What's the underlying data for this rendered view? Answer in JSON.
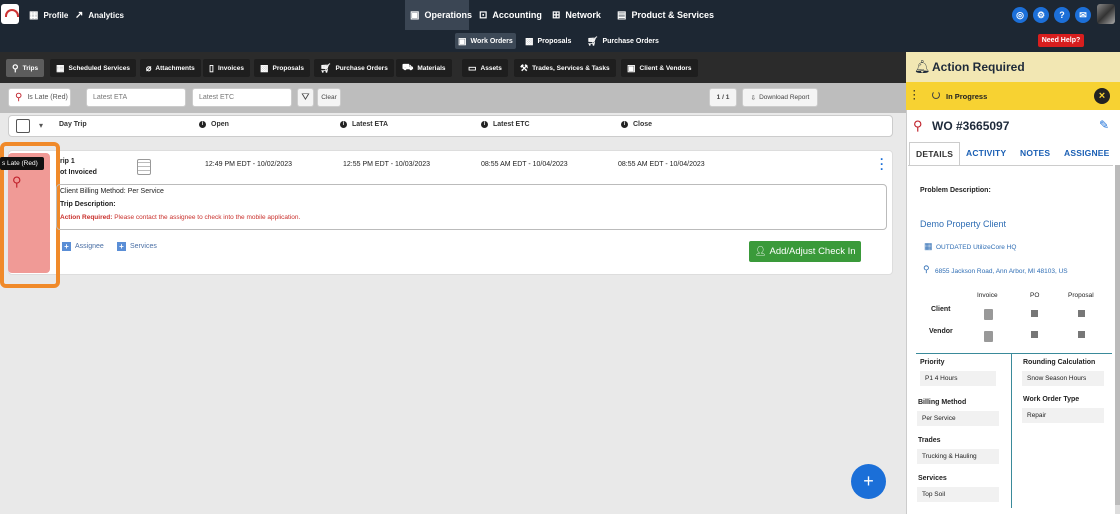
{
  "topnav": {
    "profile": "Profile",
    "analytics": "Analytics",
    "operations": "Operations",
    "accounting": "Accounting",
    "network": "Network",
    "products": "Product & Services"
  },
  "subnav": {
    "work_orders": "Work Orders",
    "proposals": "Proposals",
    "purchase_orders": "Purchase Orders",
    "need_help": "Need Help?"
  },
  "tabs": [
    "Trips",
    "Scheduled Services",
    "Attachments",
    "Invoices",
    "Proposals",
    "Purchase Orders",
    "Materials",
    "Assets",
    "Trades, Services & Tasks",
    "Client & Vendors"
  ],
  "filters": {
    "status": "Is Late (Red)",
    "eta_placeholder": "Latest ETA",
    "etc_placeholder": "Latest ETC",
    "clear": "Clear",
    "pagination": "1 / 1",
    "download": "Download Report"
  },
  "table": {
    "headers": [
      "Day Trip",
      "Open",
      "Latest ETA",
      "Latest ETC",
      "Close"
    ],
    "row": {
      "tooltip": "s Late (Red)",
      "trip": "rip 1",
      "invoice_status": "ot Invoiced",
      "open": "12:49 PM EDT - 10/02/2023",
      "eta": "12:55 PM EDT - 10/03/2023",
      "etc": "08:55 AM EDT - 10/04/2023",
      "close": "08:55 AM EDT - 10/04/2023",
      "billing_label": "Client Billing Method:",
      "billing_value": "Per Service",
      "trip_desc_label": "Trip Description:",
      "action_label": "Action Required:",
      "action_value": "Please contact the assignee to check into the mobile application.",
      "assignee": "Assignee",
      "services": "Services",
      "add_checkin": "Add/Adjust Check In"
    }
  },
  "side": {
    "header": "Action Required",
    "status": "In Progress",
    "wo": "WO #3665097",
    "tabs": [
      "DETAILS",
      "ACTIVITY",
      "NOTES",
      "ASSIGNEE"
    ],
    "problem_label": "Problem Description:",
    "client": "Demo Property Client",
    "location": "OUTDATED UtilizeCore HQ",
    "address": "6855 Jackson Road, Ann Arbor, MI 48103, US",
    "matrix_cols": [
      "Invoice",
      "PO",
      "Proposal"
    ],
    "matrix_rows": [
      "Client",
      "Vendor"
    ],
    "priority_label": "Priority",
    "priority": "P1 4 Hours",
    "rounding_label": "Rounding Calculation",
    "rounding": "Snow Season Hours",
    "billing_label": "Billing Method",
    "billing": "Per Service",
    "wotype_label": "Work Order Type",
    "wotype": "Repair",
    "trades_label": "Trades",
    "trades": "Trucking & Hauling",
    "services_label": "Services",
    "services": "Top Soil"
  },
  "colors": {
    "accent": "#1b6fd8",
    "status_yellow": "#f7d232",
    "late_red": "#f09a96",
    "highlight": "#f08a2a",
    "green": "#3a9a3a"
  }
}
